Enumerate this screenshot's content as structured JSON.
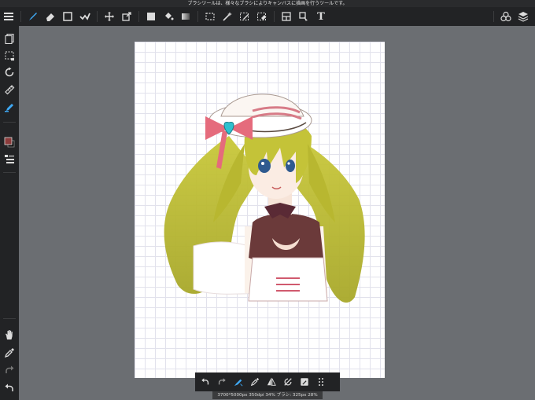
{
  "tooltip": "ブラシツールは、様々なブラシによりキャンバスに描画を行うツールです。",
  "toolbar": {
    "text_tool_glyph": "T"
  },
  "status": {
    "text": "3700*5000px 350dpi 34% ブラシ: 325px 28%"
  },
  "colors": {
    "accent": "#3fa9f5",
    "toolbar_bg": "#222325",
    "workspace_bg": "#6b6e72",
    "canvas_bg": "#ffffff",
    "primary_color": "#8b3b3b"
  },
  "icons": {
    "menu": "menu-icon",
    "brush": "brush-icon",
    "eraser": "eraser-icon",
    "shape": "shape-icon",
    "smudge": "smudge-icon",
    "move": "move-icon",
    "transform": "transform-icon",
    "fill": "fill-rect-icon",
    "bucket": "bucket-icon",
    "gradient": "gradient-icon",
    "select": "select-icon",
    "magic_wand": "magic-wand-icon",
    "select_pen": "select-pen-icon",
    "select_eraser": "select-eraser-icon",
    "frame_divider": "frame-divider-icon",
    "operation": "operation-icon",
    "text": "text-icon",
    "materials": "materials-icon",
    "layers": "layers-icon"
  }
}
